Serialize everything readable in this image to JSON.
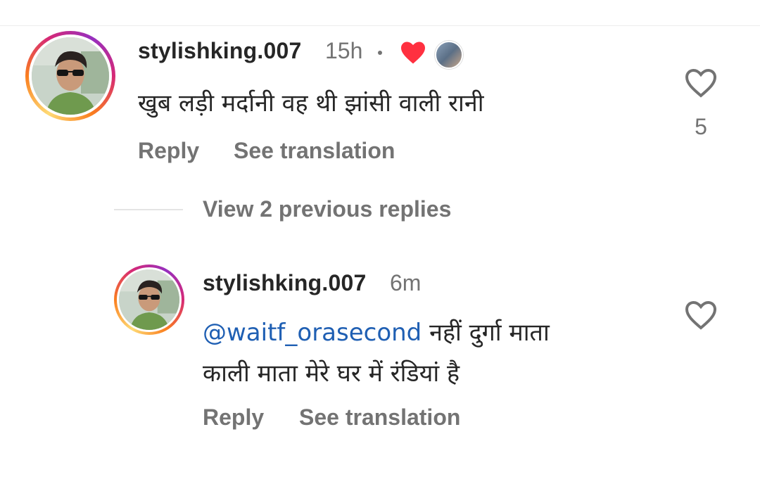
{
  "comments": [
    {
      "username": "stylishking.007",
      "time": "15h",
      "text": "खुब लड़ी मर्दानी वह थी झांसी वाली रानी",
      "reply_label": "Reply",
      "translate_label": "See translation",
      "like_count": "5"
    },
    {
      "username": "stylishking.007",
      "time": "6m",
      "mention": "@waitf_orasecond",
      "text_line1": " नहीं दुर्गा माता",
      "text_line2": "काली माता मेरे घर में रंडियां है",
      "reply_label": "Reply",
      "translate_label": "See translation"
    }
  ],
  "view_replies_label": "View 2 previous replies",
  "colors": {
    "mention": "#1f5fb3",
    "secondary_text": "#737373",
    "heart_red": "#ff3040"
  }
}
